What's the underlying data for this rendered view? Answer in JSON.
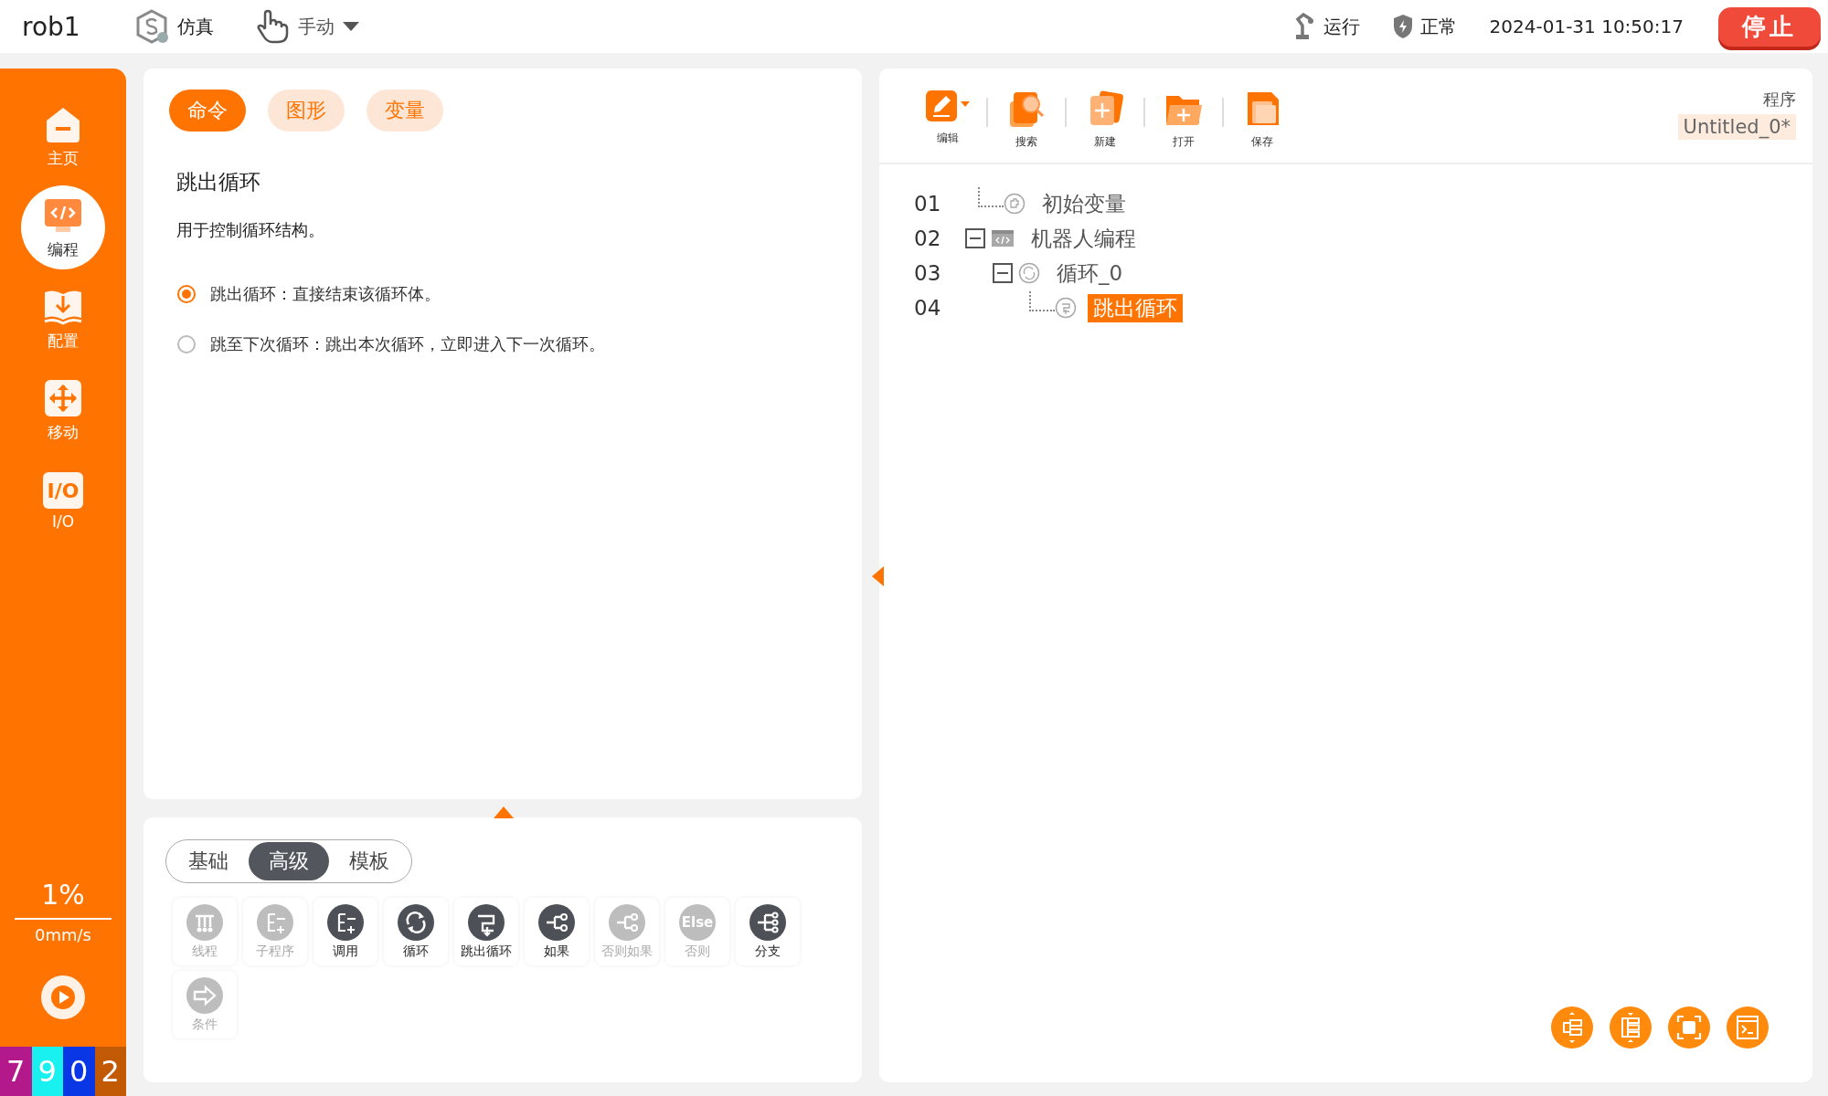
{
  "top_bar": {
    "robot": "rob1",
    "mode": "仿真",
    "control": "手动",
    "run_status": "运行",
    "health": "正常",
    "datetime": "2024-01-31 10:50:17",
    "stop_button": "停止"
  },
  "sidebar": {
    "items": [
      {
        "label": "主页",
        "kind": "home",
        "selected": false
      },
      {
        "label": "编程",
        "kind": "code",
        "selected": true
      },
      {
        "label": "配置",
        "kind": "config",
        "selected": false
      },
      {
        "label": "移动",
        "kind": "move",
        "selected": false
      },
      {
        "label": "I/O",
        "kind": "io",
        "icon_text": "I/O",
        "selected": false
      }
    ],
    "speed": "1%",
    "velocity": "0mm/s",
    "counters": [
      {
        "digit": "7",
        "color": "#b3198a"
      },
      {
        "digit": "9",
        "color": "#19f0f0"
      },
      {
        "digit": "0",
        "color": "#0a37e6"
      },
      {
        "digit": "2",
        "color": "#c25a05"
      }
    ]
  },
  "command_panel": {
    "tabs": [
      {
        "label": "命令",
        "selected": true
      },
      {
        "label": "图形",
        "selected": false
      },
      {
        "label": "变量",
        "selected": false
      }
    ],
    "title": "跳出循环",
    "description": "用于控制循环结构。",
    "options": [
      {
        "label": "跳出循环：直接结束该循环体。",
        "selected": true
      },
      {
        "label": "跳至下次循环：跳出本次循环，立即进入下一次循环。",
        "selected": false
      }
    ]
  },
  "palette": {
    "tabs": [
      {
        "label": "基础",
        "selected": false
      },
      {
        "label": "高级",
        "selected": true
      },
      {
        "label": "模板",
        "selected": false
      }
    ],
    "items": [
      {
        "label": "线程",
        "kind": "thread",
        "enabled": false
      },
      {
        "label": "子程序",
        "kind": "sub",
        "enabled": false
      },
      {
        "label": "调用",
        "kind": "sub",
        "enabled": true
      },
      {
        "label": "循环",
        "kind": "loop",
        "enabled": true
      },
      {
        "label": "跳出循环",
        "kind": "break",
        "enabled": true
      },
      {
        "label": "如果",
        "kind": "if",
        "enabled": true
      },
      {
        "label": "否则如果",
        "kind": "if",
        "enabled": false
      },
      {
        "label": "否则",
        "kind": "else",
        "icon_text": "Else",
        "enabled": false
      },
      {
        "label": "分支",
        "kind": "switch",
        "enabled": true
      },
      {
        "label": "条件",
        "kind": "arrow",
        "enabled": false
      }
    ]
  },
  "program": {
    "toolbar": [
      {
        "label": "编辑",
        "kind": "edit"
      },
      {
        "label": "搜索",
        "kind": "search"
      },
      {
        "label": "新建",
        "kind": "new"
      },
      {
        "label": "打开",
        "kind": "open"
      },
      {
        "label": "保存",
        "kind": "save"
      }
    ],
    "name_label": "程序",
    "name": "Untitled_0*",
    "tree": [
      {
        "line": "01",
        "label": "初始变量",
        "kind": "puzzle",
        "selected": false
      },
      {
        "line": "02",
        "label": "机器人编程",
        "kind": "code",
        "selected": false,
        "expanded": true,
        "children": [
          {
            "line": "03",
            "label": "循环_0",
            "kind": "loop",
            "selected": false,
            "expanded": true,
            "children": [
              {
                "line": "04",
                "label": "跳出循环",
                "kind": "break",
                "selected": true
              }
            ]
          }
        ]
      }
    ]
  }
}
